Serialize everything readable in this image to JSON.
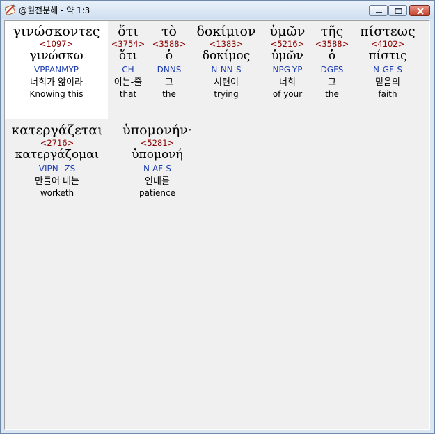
{
  "window": {
    "title": "@원전분해 - 약 1:3",
    "app_icon": "scroll-pen-icon",
    "controls": {
      "minimize": "minimize-icon",
      "maximize": "maximize-icon",
      "close": "close-icon"
    }
  },
  "colors": {
    "strong": "#8b0000",
    "parse": "#1f3fb0",
    "text": "#000000",
    "background": "#f0f0f0",
    "selected": "#ffffff"
  },
  "words": [
    {
      "greek": "γινώσκοντες",
      "strong": "<1097>",
      "lemma": "γινώσκω",
      "parse": "VPPANMYP",
      "korean": "너희가 앎이라",
      "english": "Knowing this"
    },
    {
      "greek": "ὅτι",
      "strong": "<3754>",
      "lemma": "ὅτι",
      "parse": "CH",
      "korean": "이는-줄",
      "english": "that"
    },
    {
      "greek": "τὸ",
      "strong": "<3588>",
      "lemma": "ὁ",
      "parse": "DNNS",
      "korean": "그",
      "english": "the"
    },
    {
      "greek": "δοκίμιον",
      "strong": "<1383>",
      "lemma": "δοκίμος",
      "parse": "N-NN-S",
      "korean": "시련이",
      "english": "trying"
    },
    {
      "greek": "ὑμῶν",
      "strong": "<5216>",
      "lemma": "ὑμῶν",
      "parse": "NPG-YP",
      "korean": "너희",
      "english": "of your"
    },
    {
      "greek": "τῆς",
      "strong": "<3588>",
      "lemma": "ὁ",
      "parse": "DGFS",
      "korean": "그",
      "english": "the"
    },
    {
      "greek": "πίστεως",
      "strong": "<4102>",
      "lemma": "πίστις",
      "parse": "N-GF-S",
      "korean": "믿음의",
      "english": "faith"
    },
    {
      "greek": "κατεργάζεται",
      "strong": "<2716>",
      "lemma": "κατεργάζομαι",
      "parse": "VIPN--ZS",
      "korean": "만들어 내는",
      "english": "worketh"
    },
    {
      "greek": "ὑπομονήν·",
      "strong": "<5281>",
      "lemma": "ὑπομονή",
      "parse": "N-AF-S",
      "korean": "인내를",
      "english": "patience"
    }
  ]
}
